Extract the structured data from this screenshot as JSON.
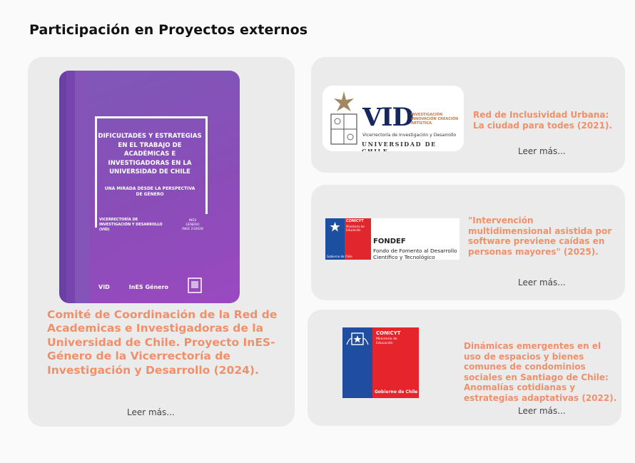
{
  "page": {
    "title": "Participación en Proyectos externos"
  },
  "cards": [
    {
      "cover": {
        "title": "DIFICULTADES Y ESTRATEGIAS EN EL TRABAJO DE ACADÉMICAS E INVESTIGADORAS EN LA UNIVERSIDAD DE CHILE",
        "subtitle": "UNA MIRADA DESDE LA PERSPECTIVA DE GÉNERO",
        "unit": "VICERRECTORÍA DE INVESTIGACIÓN Y DESARROLLO (VID)",
        "series": "INES GÉNERO INGE 210028",
        "logo1": "VID",
        "logo2": "InES Género"
      },
      "text": "Comité de Coordinación de la Red de Academicas e Investigadoras de la Universidad de Chile. Proyecto InES-Género de la Vicerrectoría de Investigación y Desarrollo (2024).",
      "more": "Leer más..."
    },
    {
      "logo": {
        "letters": "VID",
        "tag": "INVESTIGACIÓN INNOVACIÓN CREACIÓN ARTÍSTICA",
        "sub": "Vicerrectoría de Investigación y Desarrollo",
        "uni": "UNIVERSIDAD DE CHILE"
      },
      "text": "Red de Inclusividad Urbana: La ciudad para todes (2021).",
      "more": "Leer más..."
    },
    {
      "logo": {
        "brand": "CONICYT",
        "ministry": "Ministerio de Educación",
        "gov": "Gobierno de Chile",
        "name": "FONDEF",
        "desc": "Fondo de Fomento al Desarrollo Científico y Tecnológico"
      },
      "text": "\"Intervención multidimensional asistida por software previene caídas en personas mayores\" (2025).",
      "more": "Leer más..."
    },
    {
      "logo": {
        "brand": "CONICYT",
        "ministry": "Ministerio de Educación",
        "gov": "Gobierno de Chile"
      },
      "text": "Dinámicas emergentes en el uso de espacios y bienes comunes de condominios sociales en Santiago de Chile: Anomalías cotidianas y estrategias adaptativas (2022).",
      "more": "Leer más..."
    }
  ],
  "colors": {
    "accent": "#f0906a",
    "card_bg": "#ebebeb",
    "book_purple": "#8a4db8",
    "gov_blue": "#1f4d9f",
    "gov_red": "#e5242b"
  }
}
